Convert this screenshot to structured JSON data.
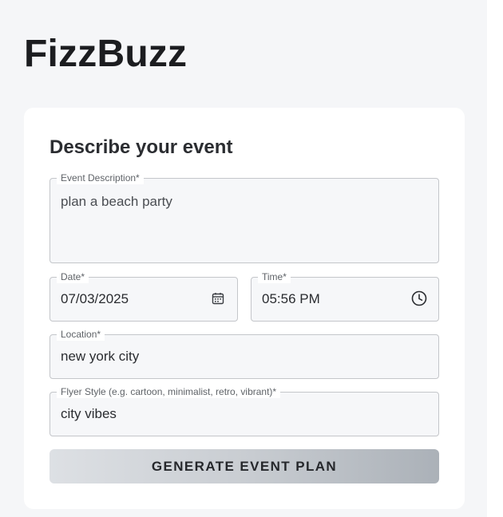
{
  "app": {
    "title": "FizzBuzz"
  },
  "form": {
    "heading": "Describe your event",
    "fields": {
      "description": {
        "label": "Event Description",
        "value": "plan a beach party",
        "required_mark": "*"
      },
      "date": {
        "label": "Date",
        "value": "07/03/2025",
        "required_mark": "*",
        "icon": "calendar-icon"
      },
      "time": {
        "label": "Time",
        "value": "05:56 PM",
        "required_mark": "*",
        "icon": "clock-icon"
      },
      "location": {
        "label": "Location",
        "value": "new york city",
        "required_mark": "*"
      },
      "flyer_style": {
        "label": "Flyer Style (e.g. cartoon, minimalist, retro, vibrant)",
        "value": "city vibes",
        "required_mark": "*"
      }
    },
    "submit_label": "GENERATE EVENT PLAN"
  },
  "colors": {
    "page_background": "#f5f6f8",
    "card_background": "#ffffff",
    "field_border": "#c4c6ca",
    "button_gradient_start": "#dde0e4",
    "button_gradient_end": "#abb1b8"
  }
}
